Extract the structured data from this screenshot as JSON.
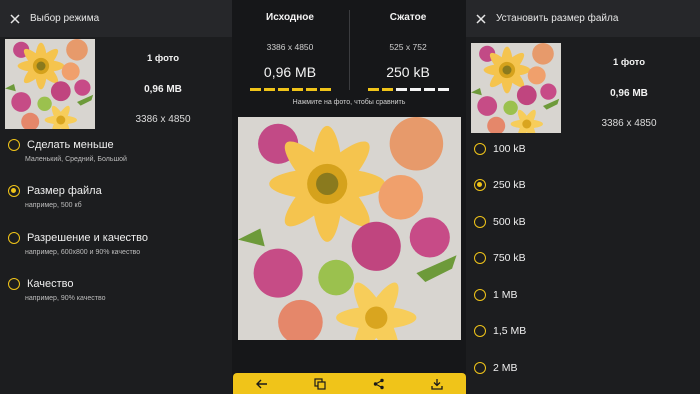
{
  "left_panel": {
    "title": "Выбор режима",
    "photo_count": "1 фото",
    "file_size": "0,96 MB",
    "dimensions": "3386 x 4850",
    "options": [
      {
        "label": "Сделать меньше",
        "hint": "Маленький, Средний, Большой",
        "selected": false
      },
      {
        "label": "Размер файла",
        "hint": "например, 500 кб",
        "selected": true
      },
      {
        "label": "Разрешение и качество",
        "hint": "например, 600x800 и 90% качество",
        "selected": false
      },
      {
        "label": "Качество",
        "hint": "например, 90% качество",
        "selected": false
      }
    ]
  },
  "compare": {
    "original": {
      "header": "Исходное",
      "dimensions": "3386 x 4850",
      "size": "0,96 MB"
    },
    "compressed": {
      "header": "Сжатое",
      "dimensions": "525 x 752",
      "size": "250 kB"
    },
    "hint": "Нажмите на фото, чтобы сравнить"
  },
  "bottom_bar": {
    "icons": [
      "back-arrow-icon",
      "copy-icon",
      "share-icon",
      "download-icon"
    ]
  },
  "right_panel": {
    "title": "Установить размер файла",
    "photo_count": "1 фото",
    "file_size": "0,96 MB",
    "dimensions": "3386 x 4850",
    "options": [
      {
        "label": "100 kB",
        "selected": false
      },
      {
        "label": "250 kB",
        "selected": true
      },
      {
        "label": "500 kB",
        "selected": false
      },
      {
        "label": "750 kB",
        "selected": false
      },
      {
        "label": "1 MB",
        "selected": false
      },
      {
        "label": "1,5 MB",
        "selected": false
      },
      {
        "label": "2 MB",
        "selected": false
      }
    ]
  },
  "colors": {
    "accent": "#f0c419",
    "panel": "#1c1d1f",
    "topbar": "#26272a"
  }
}
